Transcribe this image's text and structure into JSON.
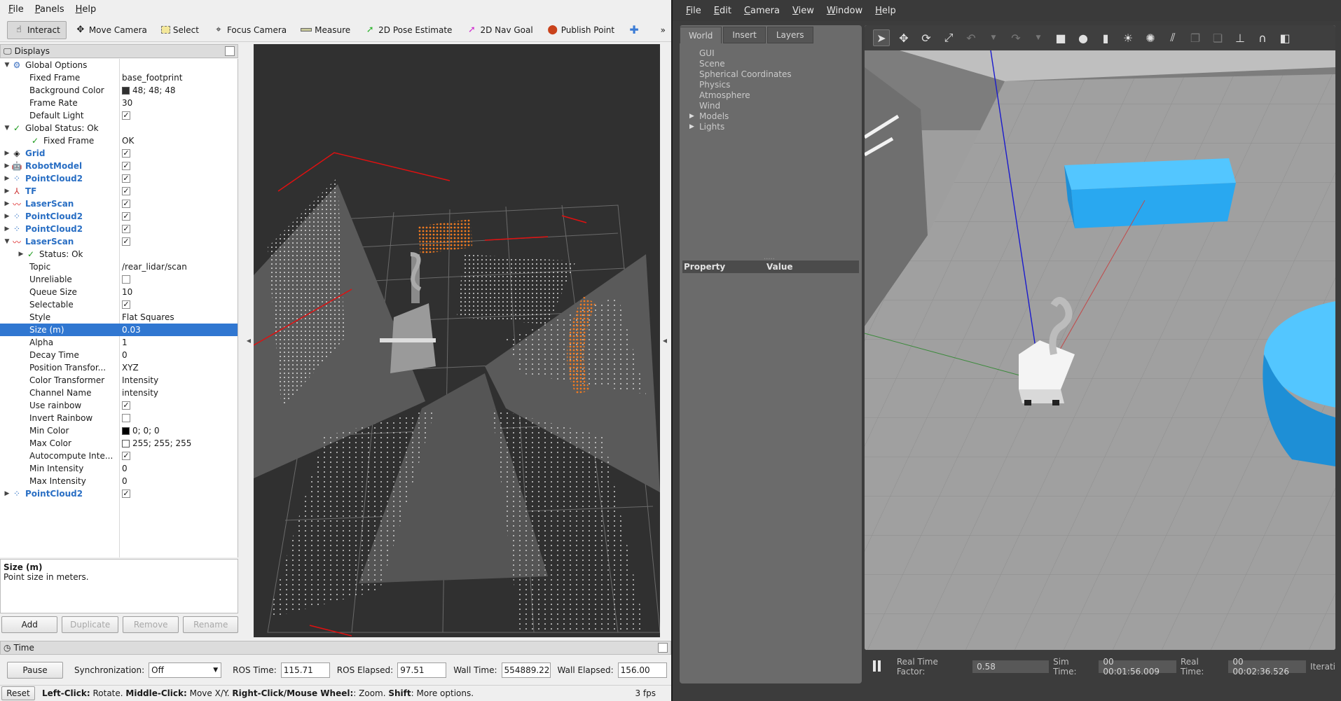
{
  "rviz": {
    "menu": [
      "File",
      "Panels",
      "Help"
    ],
    "toolbar": [
      {
        "label": "Interact",
        "icon": "hand-pointer-icon",
        "active": true
      },
      {
        "label": "Move Camera",
        "icon": "move-camera-icon"
      },
      {
        "label": "Select",
        "icon": "select-icon"
      },
      {
        "label": "Focus Camera",
        "icon": "focus-camera-icon"
      },
      {
        "label": "Measure",
        "icon": "measure-icon"
      },
      {
        "label": "2D Pose Estimate",
        "icon": "pose-estimate-icon"
      },
      {
        "label": "2D Nav Goal",
        "icon": "nav-goal-icon"
      },
      {
        "label": "Publish Point",
        "icon": "publish-point-icon"
      }
    ],
    "toolbar_more": "»",
    "displays_title": "Displays",
    "tree": [
      {
        "label": "Global Options",
        "value": ""
      },
      {
        "label": "Fixed Frame",
        "value": "base_footprint"
      },
      {
        "label": "Background Color",
        "value": "48; 48; 48"
      },
      {
        "label": "Frame Rate",
        "value": "30"
      },
      {
        "label": "Default Light",
        "value": ""
      },
      {
        "label": "Global Status: Ok",
        "value": ""
      },
      {
        "label": "Fixed Frame",
        "value": "OK"
      },
      {
        "label": "Grid",
        "value": ""
      },
      {
        "label": "RobotModel",
        "value": ""
      },
      {
        "label": "PointCloud2",
        "value": ""
      },
      {
        "label": "TF",
        "value": ""
      },
      {
        "label": "LaserScan",
        "value": ""
      },
      {
        "label": "PointCloud2",
        "value": ""
      },
      {
        "label": "PointCloud2",
        "value": ""
      },
      {
        "label": "LaserScan",
        "value": ""
      },
      {
        "label": "Status: Ok",
        "value": ""
      },
      {
        "label": "Topic",
        "value": "/rear_lidar/scan"
      },
      {
        "label": "Unreliable",
        "value": ""
      },
      {
        "label": "Queue Size",
        "value": "10"
      },
      {
        "label": "Selectable",
        "value": ""
      },
      {
        "label": "Style",
        "value": "Flat Squares"
      },
      {
        "label": "Size (m)",
        "value": "0.03"
      },
      {
        "label": "Alpha",
        "value": "1"
      },
      {
        "label": "Decay Time",
        "value": "0"
      },
      {
        "label": "Position Transfor...",
        "value": "XYZ"
      },
      {
        "label": "Color Transformer",
        "value": "Intensity"
      },
      {
        "label": "Channel Name",
        "value": "intensity"
      },
      {
        "label": "Use rainbow",
        "value": ""
      },
      {
        "label": "Invert Rainbow",
        "value": ""
      },
      {
        "label": "Min Color",
        "value": "0; 0; 0"
      },
      {
        "label": "Max Color",
        "value": "255; 255; 255"
      },
      {
        "label": "Autocompute Inte...",
        "value": ""
      },
      {
        "label": "Min Intensity",
        "value": "0"
      },
      {
        "label": "Max Intensity",
        "value": "0"
      },
      {
        "label": "PointCloud2",
        "value": ""
      }
    ],
    "desc_title": "Size (m)",
    "desc_text": "Point size in meters.",
    "buttons": {
      "add": "Add",
      "duplicate": "Duplicate",
      "remove": "Remove",
      "rename": "Rename"
    },
    "time_title": "Time",
    "time": {
      "pause": "Pause",
      "sync_label": "Synchronization:",
      "sync_value": "Off",
      "ros_time_label": "ROS Time:",
      "ros_time": "115.71",
      "ros_elapsed_label": "ROS Elapsed:",
      "ros_elapsed": "97.51",
      "wall_time_label": "Wall Time:",
      "wall_time": "554889.22",
      "wall_elapsed_label": "Wall Elapsed:",
      "wall_elapsed": "156.00"
    },
    "status": {
      "reset": "Reset",
      "left_click": "Left-Click:",
      "left_click_text": " Rotate. ",
      "middle_click": "Middle-Click:",
      "middle_click_text": " Move X/Y. ",
      "right_click": "Right-Click/Mouse Wheel:",
      "right_click_text": ": Zoom. ",
      "shift": "Shift",
      "shift_text": ": More options.",
      "fps": "3 fps"
    },
    "colors": {
      "selection": "#3077d1",
      "viewport_bg": "#303030"
    }
  },
  "gazebo": {
    "menu": [
      "File",
      "Edit",
      "Camera",
      "View",
      "Window",
      "Help"
    ],
    "tabs": [
      "World",
      "Insert",
      "Layers"
    ],
    "tree": [
      "GUI",
      "Scene",
      "Spherical Coordinates",
      "Physics",
      "Atmosphere",
      "Wind",
      "Models",
      "Lights"
    ],
    "prop_header": {
      "property": "Property",
      "value": "Value"
    },
    "bottom": {
      "rtf_label": "Real Time Factor:",
      "rtf": "0.58",
      "sim_label": "Sim Time:",
      "sim": "00 00:01:56.009",
      "real_label": "Real Time:",
      "real": "00 00:02:36.526",
      "iter_label": "Iterati"
    },
    "colors": {
      "box": "#29a8f0",
      "floor": "#9a9a9a"
    }
  }
}
